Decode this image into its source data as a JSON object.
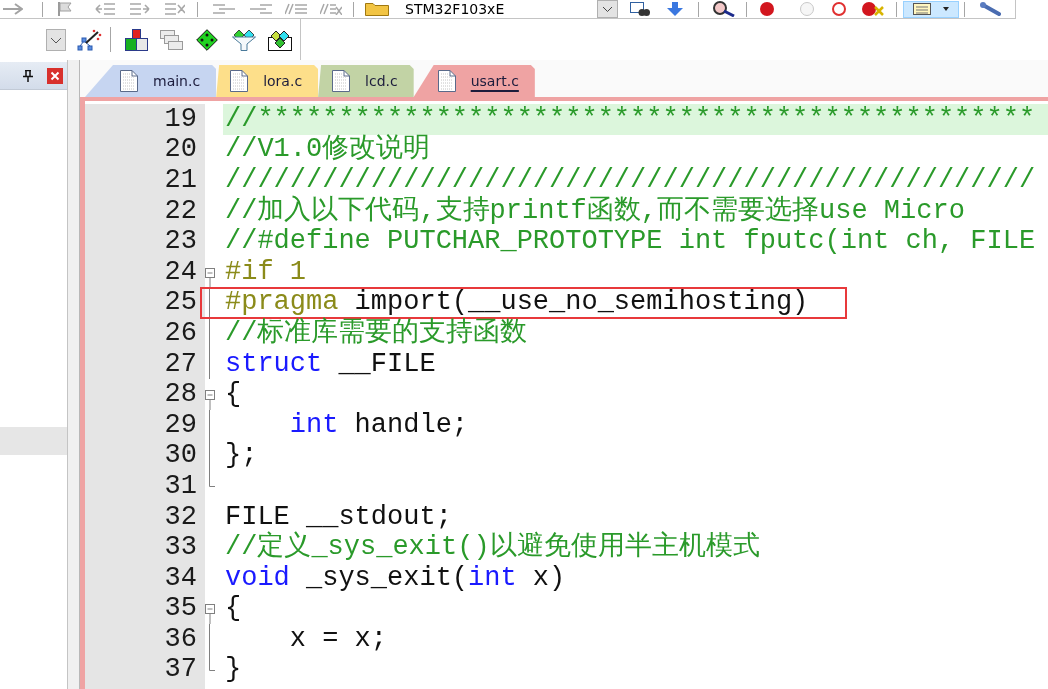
{
  "toolbar": {
    "target": "STM32F103xE",
    "toggle_button": {
      "on": true
    }
  },
  "sidebar": {
    "highlighted_row": true
  },
  "tabs": [
    {
      "label": "main.c",
      "color": "#c6d5f1",
      "selected": false
    },
    {
      "label": "lora.c",
      "color": "#fddf8a",
      "selected": false
    },
    {
      "label": "lcd.c",
      "color": "#c2d3a5",
      "selected": false
    },
    {
      "label": "usart.c",
      "color": "#efa3a3",
      "selected": true
    }
  ],
  "editor": {
    "lines": [
      {
        "number": "19",
        "kind": "plain",
        "tokens": [
          {
            "kind": "comment",
            "text": "//************************************************"
          }
        ],
        "highlighted": true,
        "boxed": false
      },
      {
        "number": "20",
        "kind": "plain",
        "tokens": [
          {
            "kind": "comment",
            "text": "//V1.0修改说明"
          }
        ],
        "highlighted": false,
        "boxed": false
      },
      {
        "number": "21",
        "kind": "plain",
        "tokens": [
          {
            "kind": "comment",
            "text": "//////////////////////////////////////////////////"
          }
        ],
        "highlighted": false,
        "boxed": false
      },
      {
        "number": "22",
        "kind": "plain",
        "tokens": [
          {
            "kind": "comment",
            "text": "//加入以下代码,支持printf函数,而不需要选择use Micro"
          }
        ],
        "highlighted": false,
        "boxed": false
      },
      {
        "number": "23",
        "kind": "plain",
        "tokens": [
          {
            "kind": "comment",
            "text": "//#define PUTCHAR_PROTOTYPE int fputc(int ch, FILE"
          }
        ],
        "highlighted": false,
        "boxed": false
      },
      {
        "number": "24",
        "kind": "fold_start",
        "tokens": [
          {
            "kind": "preprocessor",
            "text": "#if 1"
          }
        ],
        "highlighted": false,
        "boxed": false
      },
      {
        "number": "25",
        "kind": "fold_body",
        "tokens": [
          {
            "kind": "preprocessor",
            "text": "#pragma"
          },
          {
            "kind": "plain",
            "text": " import(__use_no_semihosting)"
          }
        ],
        "highlighted": false,
        "boxed": true
      },
      {
        "number": "26",
        "kind": "fold_body",
        "tokens": [
          {
            "kind": "comment",
            "text": "//标准库需要的支持函数"
          }
        ],
        "highlighted": false,
        "boxed": false
      },
      {
        "number": "27",
        "kind": "fold_body",
        "tokens": [
          {
            "kind": "keyword",
            "text": "struct"
          },
          {
            "kind": "plain",
            "text": " __FILE"
          }
        ],
        "highlighted": false,
        "boxed": false
      },
      {
        "number": "28",
        "kind": "fold_start",
        "tokens": [
          {
            "kind": "plain",
            "text": "{"
          }
        ],
        "highlighted": false,
        "boxed": false
      },
      {
        "number": "29",
        "kind": "fold_body",
        "tokens": [
          {
            "kind": "keyword",
            "text": "    int"
          },
          {
            "kind": "plain",
            "text": " handle;"
          }
        ],
        "highlighted": false,
        "boxed": false
      },
      {
        "number": "30",
        "kind": "fold_body",
        "tokens": [
          {
            "kind": "plain",
            "text": "};"
          }
        ],
        "highlighted": false,
        "boxed": false
      },
      {
        "number": "31",
        "kind": "fold_end",
        "highlighted": false,
        "boxed": false
      },
      {
        "number": "32",
        "kind": "plain",
        "tokens": [
          {
            "kind": "plain",
            "text": "FILE __stdout;"
          }
        ],
        "highlighted": false,
        "boxed": false
      },
      {
        "number": "33",
        "kind": "plain",
        "tokens": [
          {
            "kind": "comment",
            "text": "//定义_sys_exit()以避免使用半主机模式"
          }
        ],
        "highlighted": false,
        "boxed": false
      },
      {
        "number": "34",
        "kind": "plain",
        "tokens": [
          {
            "kind": "keyword",
            "text": "void"
          },
          {
            "kind": "plain",
            "text": " _sys_exit("
          },
          {
            "kind": "keyword",
            "text": "int"
          },
          {
            "kind": "plain",
            "text": " x)"
          }
        ],
        "highlighted": false,
        "boxed": false
      },
      {
        "number": "35",
        "kind": "fold_start",
        "tokens": [
          {
            "kind": "plain",
            "text": "{"
          }
        ],
        "highlighted": false,
        "boxed": false
      },
      {
        "number": "36",
        "kind": "fold_body",
        "tokens": [
          {
            "kind": "plain",
            "text": "    x = x;"
          }
        ],
        "highlighted": false,
        "boxed": false
      },
      {
        "number": "37",
        "kind": "fold_end",
        "tokens": [
          {
            "kind": "plain",
            "text": "}"
          }
        ],
        "highlighted": false,
        "boxed": false
      }
    ]
  }
}
